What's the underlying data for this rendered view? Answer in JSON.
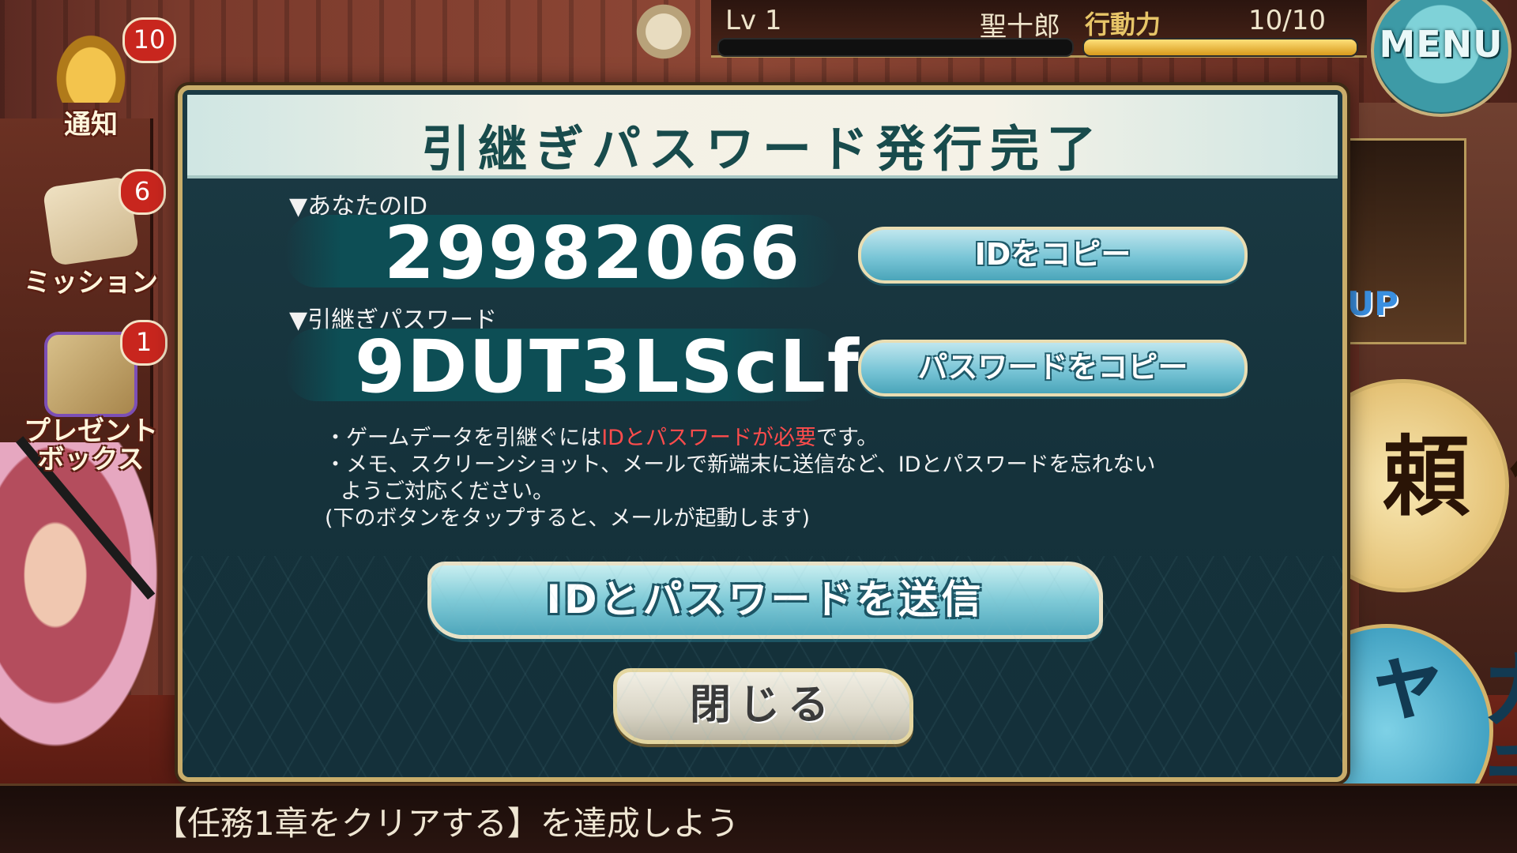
{
  "hud": {
    "level_label": "Lv  1",
    "player_name": "聖十郎",
    "stamina_label": "行動力",
    "stamina_value": "10/10",
    "stamina_fraction": 1.0,
    "menu_label": "MENU"
  },
  "side_menu": {
    "notification": {
      "label": "通知",
      "badge": "10"
    },
    "mission": {
      "label": "ミッション",
      "badge": "6"
    },
    "present_box": {
      "label": "プレゼント\nボックス",
      "badge": "1"
    }
  },
  "right_menu": {
    "banner_up_text": "UP",
    "irai_label": "依頼",
    "gacha_label": "ガチャ"
  },
  "dialog": {
    "title": "引継ぎパスワード発行完了",
    "id_section_label": "▼あなたのID",
    "id_value": "29982066",
    "copy_id_button": "IDをコピー",
    "password_section_label": "▼引継ぎパスワード",
    "password_value": "9DUT3LScLf",
    "copy_password_button": "パスワードをコピー",
    "note1_prefix": "・ゲームデータを引継ぐには",
    "note1_highlight": "IDとパスワードが必要",
    "note1_suffix": "です。",
    "note2": "・メモ、スクリーンショット、メールで新端末に送信など、IDとパスワードを忘れない",
    "note3": "ようご対応ください。",
    "note4": "(下のボタンをタップすると、メールが起動します)",
    "send_button": "IDとパスワードを送信",
    "close_button": "閉じる"
  },
  "ticker": {
    "text": "【任務1章をクリアする】を達成しよう"
  },
  "colors": {
    "accent_teal": "#79c5d6",
    "frame_gold": "#c9ad6a",
    "highlight_red": "#ff4c4c",
    "dialog_bg": "#15323b"
  }
}
